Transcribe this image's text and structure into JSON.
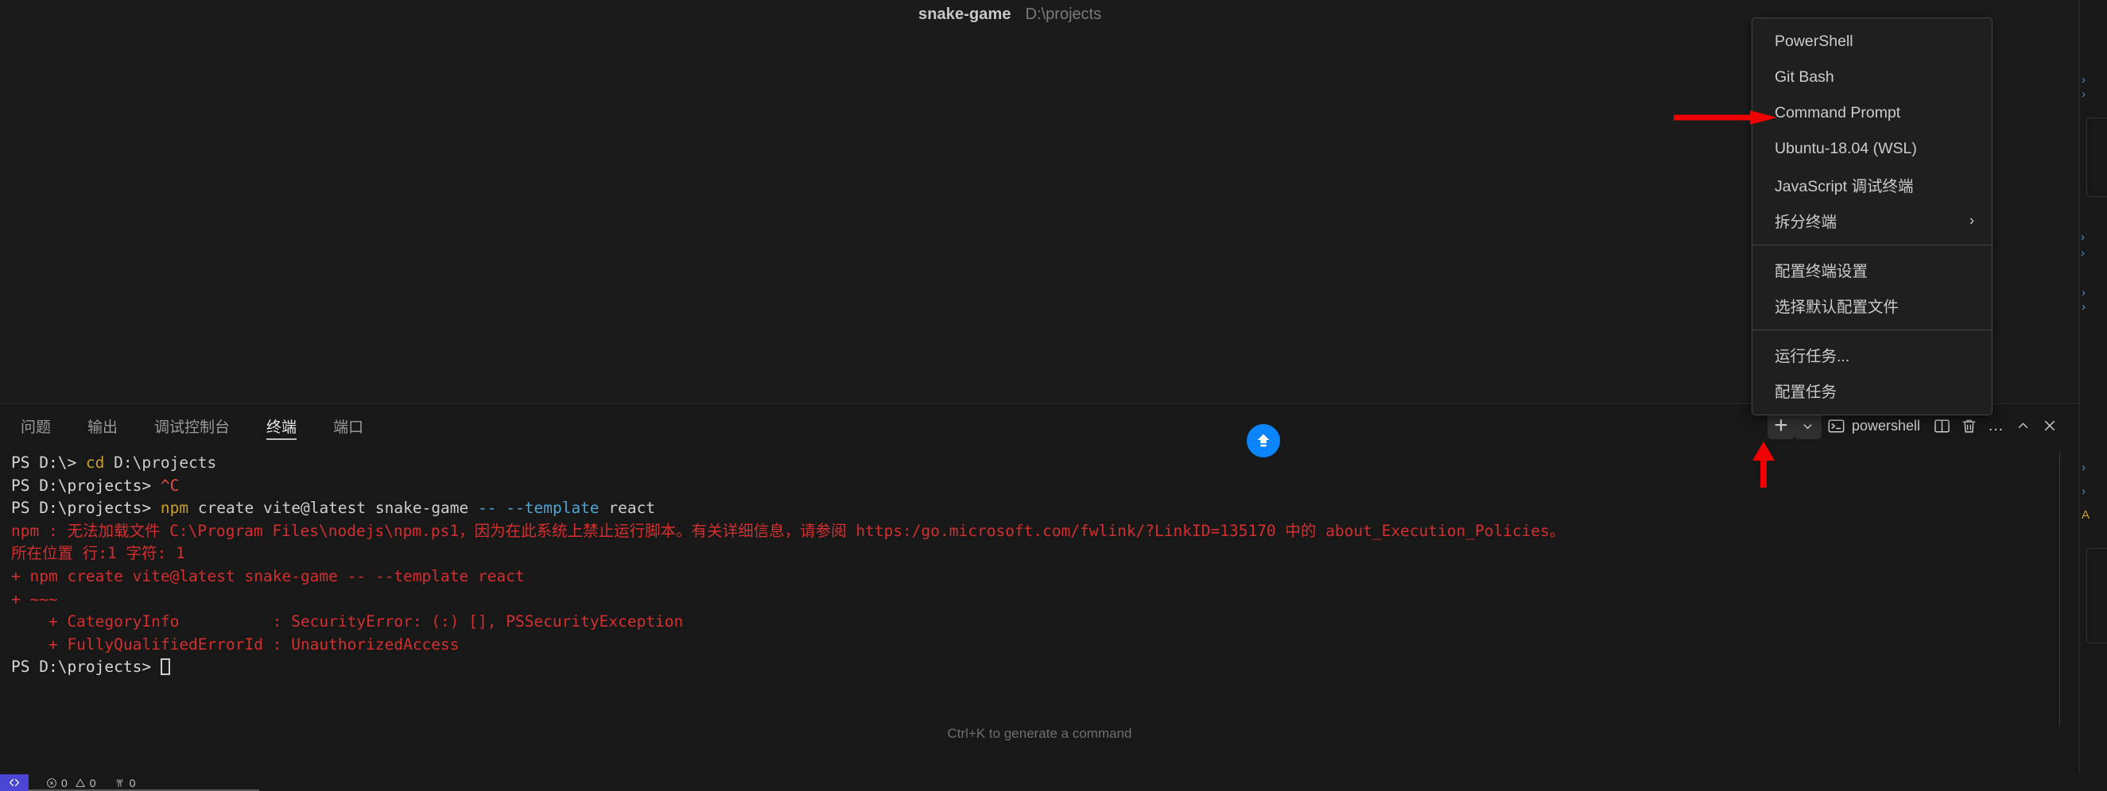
{
  "breadcrumb": {
    "project": "snake-game",
    "path": "D:\\projects"
  },
  "terminal_dropdown": {
    "groups": [
      {
        "items": [
          {
            "label": "PowerShell",
            "submenu": false
          },
          {
            "label": "Git Bash",
            "submenu": false
          },
          {
            "label": "Command Prompt",
            "submenu": false
          },
          {
            "label": "Ubuntu-18.04 (WSL)",
            "submenu": false
          },
          {
            "label": "JavaScript 调试终端",
            "submenu": false
          },
          {
            "label": "拆分终端",
            "submenu": true,
            "chevron": "›"
          }
        ]
      },
      {
        "items": [
          {
            "label": "配置终端设置",
            "submenu": false
          },
          {
            "label": "选择默认配置文件",
            "submenu": false
          }
        ]
      },
      {
        "items": [
          {
            "label": "运行任务...",
            "submenu": false
          },
          {
            "label": "配置任务",
            "submenu": false
          }
        ]
      }
    ]
  },
  "panel": {
    "tabs": [
      {
        "label": "问题",
        "active": false
      },
      {
        "label": "输出",
        "active": false
      },
      {
        "label": "调试控制台",
        "active": false
      },
      {
        "label": "终端",
        "active": true
      },
      {
        "label": "端口",
        "active": false
      }
    ],
    "actions": {
      "new_terminal": "+",
      "new_terminal_dropdown": "chevron-down-icon",
      "active_terminal_name": "powershell",
      "split": "split-terminal-icon",
      "kill": "trash-icon",
      "more": "…",
      "maximize": "⌃",
      "close": "✕"
    },
    "hint": "Ctrl+K to generate a command"
  },
  "terminal_lines": [
    [
      {
        "t": "PS D:\\> ",
        "c": "c-pp"
      },
      {
        "t": "cd",
        "c": "c-yel"
      },
      {
        "t": " D:\\projects",
        "c": "c-def"
      }
    ],
    [
      {
        "t": "PS D:\\projects> ",
        "c": "c-pp"
      },
      {
        "t": "^C",
        "c": "c-red"
      }
    ],
    [
      {
        "t": "PS D:\\projects> ",
        "c": "c-pp"
      },
      {
        "t": "npm",
        "c": "c-yel"
      },
      {
        "t": " create vite@latest snake-game ",
        "c": "c-def"
      },
      {
        "t": "--",
        "c": "c-blue"
      },
      {
        "t": " ",
        "c": "c-def"
      },
      {
        "t": "--template",
        "c": "c-blue"
      },
      {
        "t": " react",
        "c": "c-def"
      }
    ],
    [
      {
        "t": "npm : 无法加载文件 C:\\Program Files\\nodejs\\npm.ps1，因为在此系统上禁止运行脚本。有关详细信息，请参阅 https:/go.microsoft.com/fwlink/?LinkID=135170 中的 about_Execution_Policies。",
        "c": "c-red2"
      }
    ],
    [
      {
        "t": "所在位置 行:1 字符: 1",
        "c": "c-red2"
      }
    ],
    [
      {
        "t": "+ npm create vite@latest snake-game -- --template react",
        "c": "c-red2"
      }
    ],
    [
      {
        "t": "+ ~~~",
        "c": "c-red2"
      }
    ],
    [
      {
        "t": "    + CategoryInfo          : SecurityError: (:) [], PSSecurityException",
        "c": "c-red2"
      }
    ],
    [
      {
        "t": "    + FullyQualifiedErrorId : UnauthorizedAccess",
        "c": "c-red2"
      }
    ],
    [
      {
        "t": "PS D:\\projects> ",
        "c": "c-pp"
      },
      {
        "t": "__CURSOR__",
        "c": "cursor"
      }
    ]
  ],
  "status_bar": {
    "remote_icon": "remote-window-icon",
    "errors": "0",
    "warnings": "0",
    "ports": "0"
  },
  "annotations": [
    {
      "name": "arrow-to-command-prompt",
      "direction": "right",
      "color": "#f00000"
    },
    {
      "name": "arrow-to-terminal-dropdown",
      "direction": "up",
      "color": "#f00000"
    }
  ],
  "colors": {
    "background": "#1b1b1b",
    "panel_bg": "#181818",
    "menu_bg": "#1f1f1f",
    "menu_border": "#454545",
    "accent_blue": "#0b84ff",
    "remote_purple": "#4b45d6",
    "annotation_red": "#f00000",
    "terminal_red": "#d32f2f",
    "terminal_yellow": "#c8a02a"
  }
}
